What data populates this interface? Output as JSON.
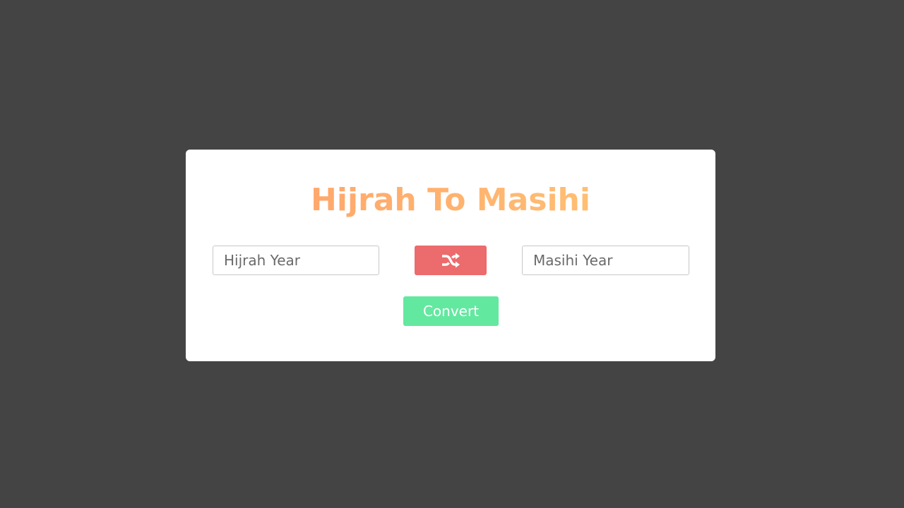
{
  "title": "Hijrah To Masihi",
  "hijrah_input": {
    "value": "",
    "placeholder": "Hijrah Year"
  },
  "masihi_input": {
    "value": "",
    "placeholder": "Masihi Year"
  },
  "swap_button": {
    "icon": "shuffle-icon"
  },
  "convert_button": {
    "label": "Convert"
  },
  "colors": {
    "background": "#444444",
    "card": "#ffffff",
    "title_gradient_start": "#ff9f6b",
    "title_gradient_end": "#ffc977",
    "swap_button": "#ec6b6c",
    "convert_button": "#63e8a0"
  }
}
